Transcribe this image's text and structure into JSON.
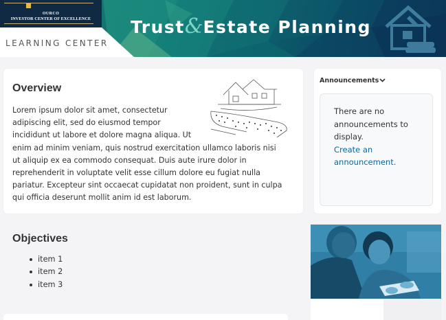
{
  "banner": {
    "logo_name": "OURCO",
    "logo_subtitle": "INVESTOR CENTER OF EXCELLENCE",
    "section_label": "LEARNING CENTER",
    "title_part1": "Trust",
    "title_amp": "&",
    "title_part2": "Estate Planning",
    "icon": "house-hammer-icon",
    "colors": {
      "teal": "#17807a",
      "navy": "#0b2f52"
    }
  },
  "overview": {
    "title": "Overview",
    "body": "Lorem ipsum dolor sit amet, consectetur adipiscing elit, sed do eiusmod tempor incididunt ut labore et dolore magna aliqua. Ut enim ad minim veniam, quis nostrud exercitation ullamco laboris nisi ut aliquip ex ea commodo consequat. Duis aute irure dolor in reprehenderit in voluptate velit esse cillum dolore eu fugiat nulla pariatur. Excepteur sint occaecat cupidatat non proident, sunt in culpa qui officia deserunt mollit anim id est laborum.",
    "illustration": "house-in-hand-illustration"
  },
  "announcements": {
    "heading": "Announcements",
    "empty_text": "There are no announcements to display.",
    "create_link": "Create an announcement."
  },
  "objectives": {
    "title": "Objectives",
    "items": [
      "item 1",
      "item 2",
      "item 3"
    ]
  },
  "photo": {
    "subject": "couple-reviewing-tablet-photo"
  }
}
